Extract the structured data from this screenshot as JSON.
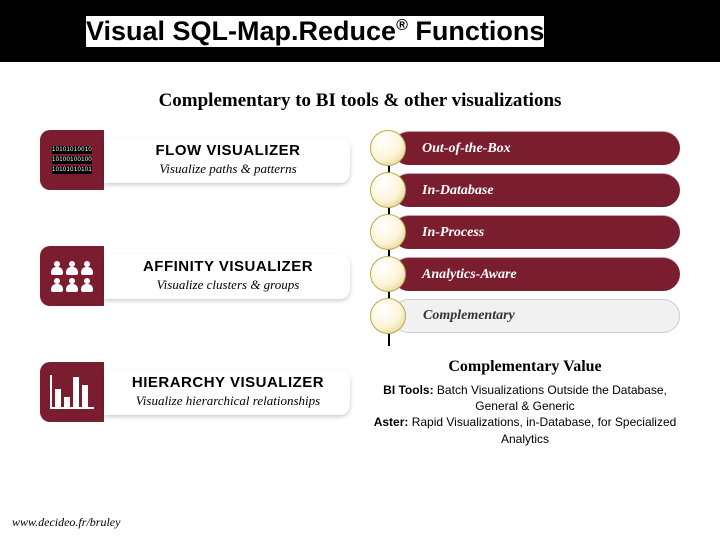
{
  "title_pre": "Visual SQL-Map.Reduce",
  "title_sup": "®",
  "title_post": " Functions",
  "subtitle": "Complementary to BI tools & other visualizations",
  "cards": [
    {
      "title": "FLOW VISUALIZER",
      "sub": "Visualize paths & patterns"
    },
    {
      "title": "AFFINITY VISUALIZER",
      "sub": "Visualize clusters & groups"
    },
    {
      "title": "HIERARCHY VISUALIZER",
      "sub": "Visualize hierarchical relationships"
    }
  ],
  "pills": [
    {
      "label": "Out-of-the-Box",
      "light": false
    },
    {
      "label": "In-Database",
      "light": false
    },
    {
      "label": "In-Process",
      "light": false
    },
    {
      "label": "Analytics-Aware",
      "light": false
    },
    {
      "label": "Complementary",
      "light": true
    }
  ],
  "comp": {
    "title": "Complementary Value",
    "line1_label": "BI Tools:",
    "line1_text": " Batch Visualizations Outside the Database, General & Generic",
    "line2_label": "Aster:",
    "line2_text": " Rapid Visualizations, in-Database, for Specialized Analytics"
  },
  "footer": "www.decideo.fr/bruley",
  "binary": [
    "10101010010",
    "10100100100",
    "10101010101"
  ]
}
